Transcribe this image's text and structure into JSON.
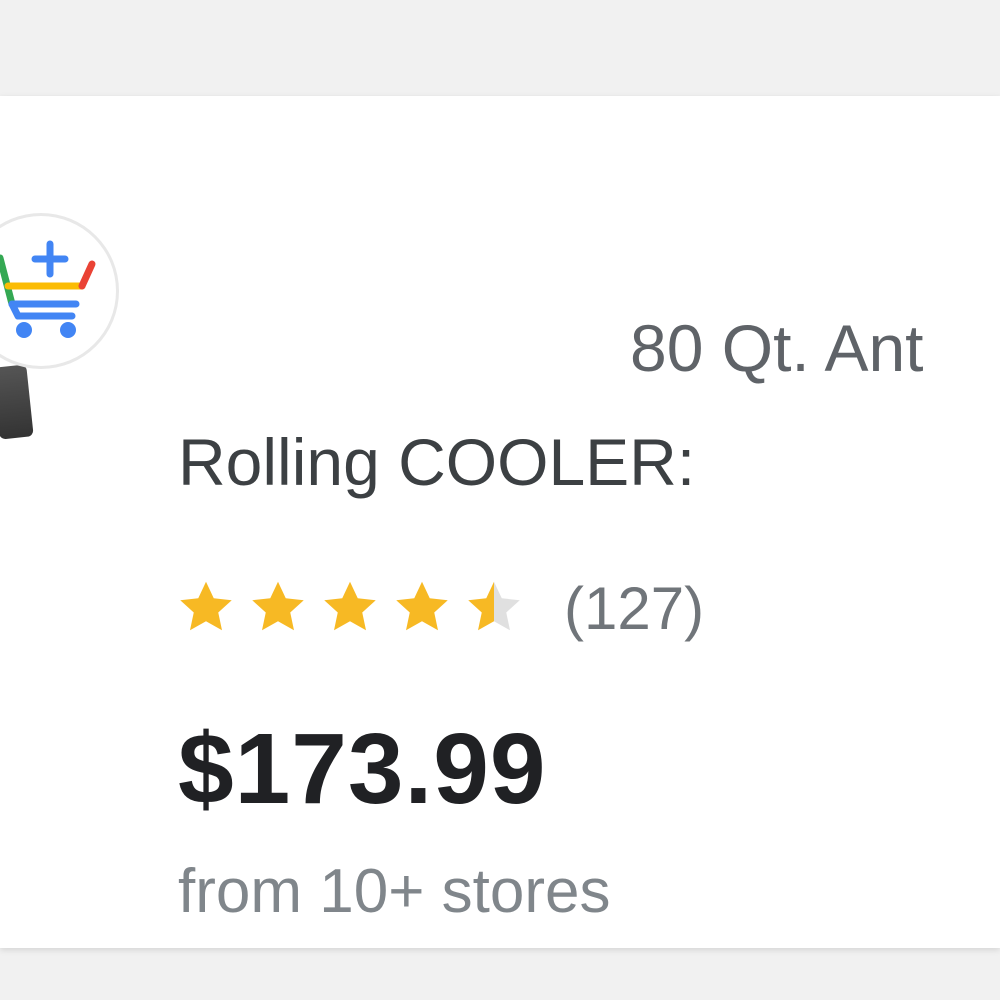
{
  "product": {
    "title_line1": "80 Qt. Ant",
    "title_line2": "Rolling COOLER:",
    "rating": {
      "stars_value": 4.5,
      "stars_max": 5,
      "review_count": "(127)"
    },
    "price": "$173.99",
    "stores_text": "from 10+ stores"
  },
  "icons": {
    "cart": "shopping-cart-add-icon",
    "thumbnail": "product-thumbnail"
  },
  "colors": {
    "star_filled": "#f7b924",
    "star_empty": "#e0e0e0",
    "price": "#202124",
    "title": "#3c4043",
    "secondary": "#70757a",
    "google_blue": "#4285f4",
    "google_red": "#ea4335",
    "google_yellow": "#fbbc04",
    "google_green": "#34a853"
  }
}
